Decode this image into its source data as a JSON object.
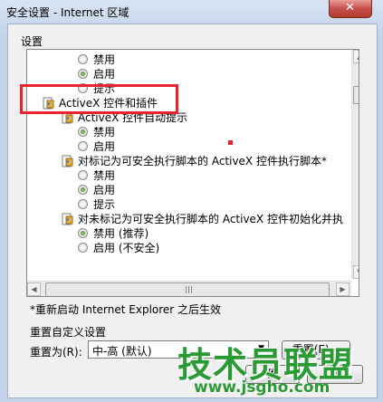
{
  "window": {
    "title": "安全设置 - Internet 区域",
    "close_glyph": "✕"
  },
  "settings": {
    "group_label": "设置",
    "rows": [
      {
        "kind": "radio",
        "label": "禁用",
        "checked": false
      },
      {
        "kind": "radio",
        "label": "启用",
        "checked": true
      },
      {
        "kind": "radio",
        "label": "提示",
        "checked": false
      },
      {
        "kind": "section",
        "label": "ActiveX 控件和插件"
      },
      {
        "kind": "section",
        "label": "ActiveX 控件自动提示"
      },
      {
        "kind": "radio",
        "label": "禁用",
        "checked": true
      },
      {
        "kind": "radio",
        "label": "启用",
        "checked": false
      },
      {
        "kind": "section",
        "label": "对标记为可安全执行脚本的 ActiveX 控件执行脚本*"
      },
      {
        "kind": "radio",
        "label": "禁用",
        "checked": false
      },
      {
        "kind": "radio",
        "label": "启用",
        "checked": true
      },
      {
        "kind": "radio",
        "label": "提示",
        "checked": false
      },
      {
        "kind": "section",
        "label": "对未标记为可安全执行脚本的 ActiveX 控件初始化并执"
      },
      {
        "kind": "radio",
        "label": "禁用 (推荐)",
        "checked": true
      },
      {
        "kind": "radio",
        "label": "启用 (不安全)",
        "checked": false
      }
    ],
    "note": "*重新启动 Internet Explorer 之后生效"
  },
  "reset": {
    "group_label": "重置自定义设置",
    "reset_to_label": "重置为(R):",
    "level_value": "中-高 (默认)",
    "reset_button": "重置(E)..."
  },
  "footer": {
    "ok_partial": "确",
    "cancel_partial": "取"
  },
  "watermark": {
    "brand": "技术员联盟",
    "url": "www.jsgho.com"
  },
  "colors": {
    "highlight": "#e8232d",
    "watermark": "#2a9b34"
  }
}
